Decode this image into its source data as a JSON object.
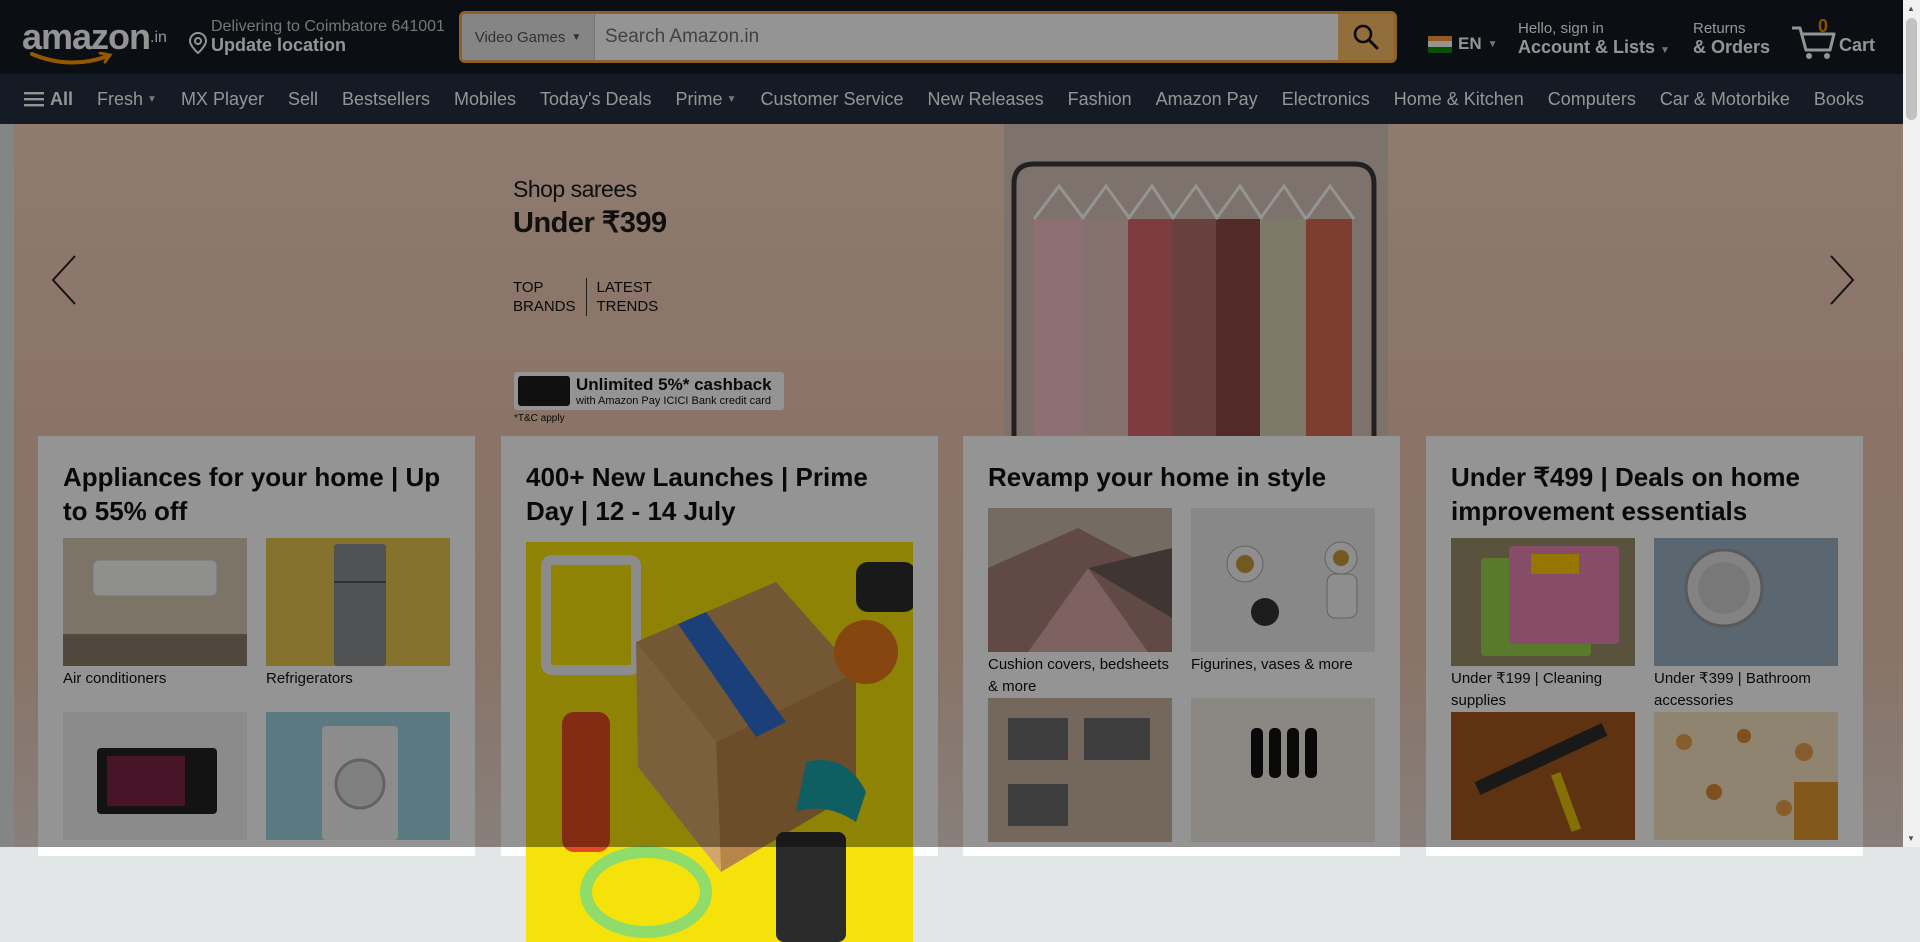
{
  "header": {
    "logo_text": "amazon",
    "logo_suffix": ".in",
    "deliver_line1": "Delivering to Coimbatore 641001",
    "deliver_line2": "Update location",
    "search_category": "Video Games",
    "search_placeholder": "Search Amazon.in",
    "language": "EN",
    "account_line1": "Hello, sign in",
    "account_line2": "Account & Lists",
    "orders_line1": "Returns",
    "orders_line2": "& Orders",
    "cart_count": "0",
    "cart_label": "Cart"
  },
  "nav": {
    "all_label": "All",
    "items": [
      {
        "label": "Fresh",
        "caret": true
      },
      {
        "label": "MX Player",
        "caret": false
      },
      {
        "label": "Sell",
        "caret": false
      },
      {
        "label": "Bestsellers",
        "caret": false
      },
      {
        "label": "Mobiles",
        "caret": false
      },
      {
        "label": "Today's Deals",
        "caret": false
      },
      {
        "label": "Prime",
        "caret": true
      },
      {
        "label": "Customer Service",
        "caret": false
      },
      {
        "label": "New Releases",
        "caret": false
      },
      {
        "label": "Fashion",
        "caret": false
      },
      {
        "label": "Amazon Pay",
        "caret": false
      },
      {
        "label": "Electronics",
        "caret": false
      },
      {
        "label": "Home & Kitchen",
        "caret": false
      },
      {
        "label": "Computers",
        "caret": false
      },
      {
        "label": "Car & Motorbike",
        "caret": false
      },
      {
        "label": "Books",
        "caret": false
      }
    ]
  },
  "hero": {
    "line1": "Shop sarees",
    "line2": "Under ₹399",
    "brands_a1": "TOP",
    "brands_a2": "BRANDS",
    "brands_b1": "LATEST",
    "brands_b2": "TRENDS",
    "cashback_title": "Unlimited 5%* cashback",
    "cashback_sub": "with Amazon Pay ICICI Bank credit card",
    "tnc": "*T&C apply"
  },
  "cards": {
    "appliances": {
      "title": "Appliances for your home | Up to 55% off",
      "tiles": [
        "Air conditioners",
        "Refrigerators"
      ]
    },
    "launches": {
      "title": "400+ New Launches | Prime Day | 12 - 14 July"
    },
    "revamp": {
      "title": "Revamp your home in style",
      "tiles": [
        "Cushion covers, bedsheets & more",
        "Figurines, vases & more"
      ]
    },
    "deals": {
      "title": "Under ₹499 | Deals on home improvement essentials",
      "tiles": [
        "Under ₹199 | Cleaning supplies",
        "Under ₹399 | Bathroom accessories"
      ]
    }
  },
  "colors": {
    "header_bg": "#131921",
    "nav_bg": "#232f3e",
    "search_button": "#febd69",
    "search_border": "#f3a847",
    "cart_count": "#f08804"
  }
}
